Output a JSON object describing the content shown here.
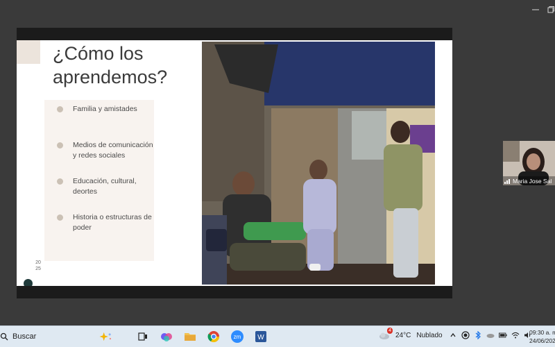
{
  "window": {
    "minimize_icon": "minimize-icon",
    "restore_icon": "restore-icon"
  },
  "slide": {
    "title": "¿Cómo los\naprendemos?",
    "bullets": [
      {
        "text": "Familia y amistades"
      },
      {
        "text": "Medios de comunicación\ny redes sociales"
      },
      {
        "text": "Educación, cultural,\ndeortes"
      },
      {
        "text": "Historia o estructuras de\npoder"
      }
    ],
    "page_number": "20\n25"
  },
  "participant": {
    "name": "Maria Jose Sal"
  },
  "taskbar": {
    "search_label": "Buscar",
    "weather": {
      "badge": "4",
      "temperature": "24°C",
      "condition": "Nublado"
    },
    "clock": {
      "time": "09:30 a. m.",
      "date": "24/06/202"
    }
  },
  "colors": {
    "taskbar_bg": "#dfe9f2",
    "slide_accent": "#ece4dc",
    "bullet_dot": "#cbc1b5"
  }
}
